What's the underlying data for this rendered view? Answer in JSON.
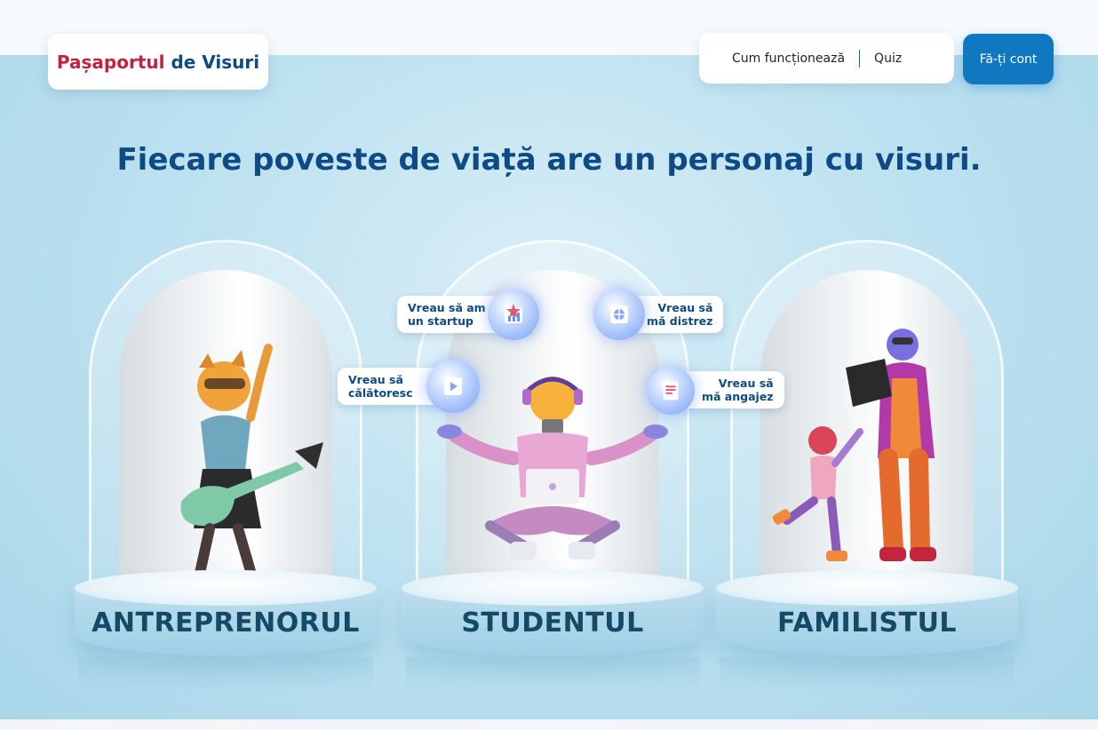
{
  "brand": {
    "part1": "Pașaportul",
    "part2": "de Visuri"
  },
  "nav": {
    "item1": "Cum funcționează",
    "item2": "Quiz"
  },
  "cta": {
    "label": "Fă-ți cont"
  },
  "headline": "Fiecare poveste de viață are un personaj cu visuri.",
  "personas": [
    {
      "label": "ANTREPRENORUL"
    },
    {
      "label": "STUDENTUL"
    },
    {
      "label": "FAMILISTUL"
    }
  ],
  "wishes": [
    {
      "line1": "Vreau să am",
      "line2": "un startup"
    },
    {
      "line1": "Vreau să",
      "line2": "mă distrez"
    },
    {
      "line1": "Vreau să",
      "line2": "călătoresc"
    },
    {
      "line1": "Vreau să",
      "line2": "mă angajez"
    }
  ],
  "colors": {
    "brand_red": "#c4203f",
    "brand_blue": "#0d4a86",
    "cta": "#1078c0"
  }
}
